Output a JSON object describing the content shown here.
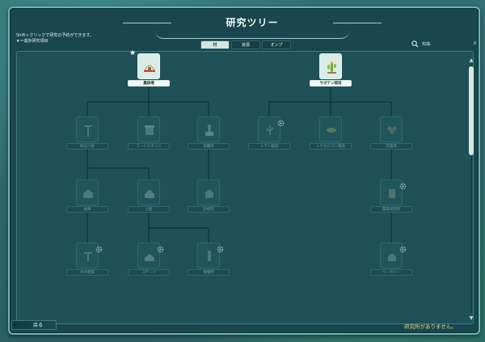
{
  "window": {
    "title": "研究ツリー",
    "hint_line1": "Shift＋クリックで研究の予約ができます。",
    "hint_line2": "★＝進捗研究項目"
  },
  "tabs": [
    {
      "label": "村",
      "active": true
    },
    {
      "label": "資源",
      "active": false
    },
    {
      "label": "オンプ",
      "active": false
    }
  ],
  "search": {
    "label": "知識:",
    "value": "0"
  },
  "nodes": [
    {
      "label": "農耕場",
      "state": "unlocked",
      "icon": "tent-icon",
      "starred": true,
      "gear": false
    },
    {
      "label": "サボテン栽培",
      "state": "unlocked",
      "icon": "cactus-icon",
      "starred": false,
      "gear": false
    },
    {
      "label": "採石小屋",
      "state": "locked",
      "icon": "crane-icon",
      "starred": false,
      "gear": false
    },
    {
      "label": "フードスタンド",
      "state": "locked",
      "icon": "stand-icon",
      "starred": false,
      "gear": false
    },
    {
      "label": "旅籠所",
      "state": "locked",
      "icon": "tower-icon",
      "starred": false,
      "gear": false
    },
    {
      "label": "トマト栽培",
      "state": "locked",
      "icon": "tomato-icon",
      "starred": false,
      "gear": true
    },
    {
      "label": "トウモロコシ栽培",
      "state": "locked",
      "icon": "corn-icon",
      "starred": false,
      "gear": false
    },
    {
      "label": "花農場",
      "state": "locked",
      "icon": "flower-icon",
      "starred": false,
      "gear": false
    },
    {
      "label": "倉庫",
      "state": "locked",
      "icon": "warehouse-icon",
      "starred": false,
      "gear": false
    },
    {
      "label": "小屋",
      "state": "locked",
      "icon": "hut-icon",
      "starred": false,
      "gear": false
    },
    {
      "label": "診療所",
      "state": "locked",
      "icon": "clinic-icon",
      "starred": false,
      "gear": false
    },
    {
      "label": "農業研究所",
      "state": "locked",
      "icon": "lab-icon",
      "starred": false,
      "gear": true
    },
    {
      "label": "木の建築",
      "state": "locked",
      "icon": "wood-icon",
      "starred": false,
      "gear": true
    },
    {
      "label": "コテージ",
      "state": "locked",
      "icon": "cottage-icon",
      "starred": false,
      "gear": true
    },
    {
      "label": "保健所",
      "state": "locked",
      "icon": "health-icon",
      "starred": false,
      "gear": true
    },
    {
      "label": "ベーカリー",
      "state": "locked",
      "icon": "bakery-icon",
      "starred": false,
      "gear": true
    }
  ],
  "footer": {
    "back_label": "戻る",
    "status": "研究所がありません。"
  },
  "colors": {
    "accent": "#6fb3b6",
    "status": "#e8d17a",
    "panel": "#1f5158"
  }
}
